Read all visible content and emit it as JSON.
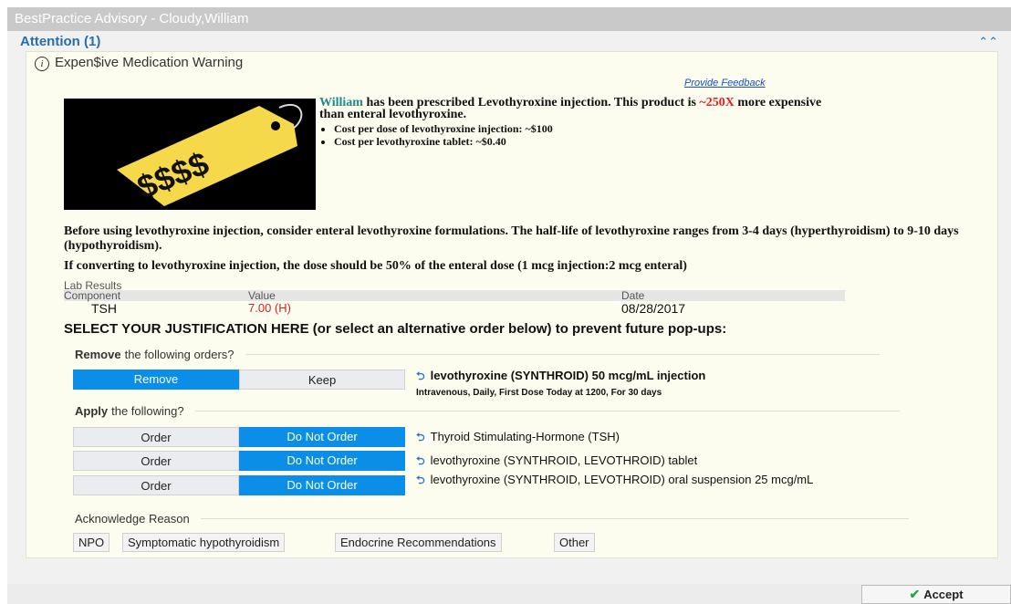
{
  "window": {
    "title": "BestPractice Advisory  - Cloudy,William"
  },
  "header": {
    "attention": "Attention (1)",
    "collapse_icon": "double-chevron-up-icon"
  },
  "warning": {
    "title": "Expen$ive Medication Warning",
    "feedback": "Provide Feedback",
    "tag_text": "$$$$"
  },
  "message": {
    "name": "William",
    "line1": " has been prescribed Levothyroxine injection.  This product is ",
    "multiplier": "~250X",
    "line2": " more expensive than enteral levothyroxine.",
    "bullets": [
      "Cost per dose of levothyroxine injection: ~$100",
      "Cost per levothyroxine tablet: ~$0.40"
    ]
  },
  "guidance": {
    "p1": "Before using levothyroxine injection, consider enteral levothyroxine formulations. The half-life of levothyroxine ranges from 3-4 days (hyperthyroidism) to 9-10 days (hypothyroidism).",
    "p2": "If converting to levothyroxine injection, the dose should be 50% of the enteral dose (1 mcg injection:2 mcg enteral)"
  },
  "lab": {
    "title": "Lab Results",
    "headers": {
      "component": "Component",
      "value": "Value",
      "date": "Date"
    },
    "row": {
      "component": "TSH",
      "value": "7.00 (H)",
      "date": "08/28/2017"
    }
  },
  "justify": "SELECT YOUR JUSTIFICATION HERE (or select an alternative order below) to prevent future pop-ups:",
  "remove_section": {
    "bold": "Remove",
    "rest": "the following orders?",
    "remove_label": "Remove",
    "keep_label": "Keep",
    "order": "levothyroxine (SYNTHROID) 50 mcg/mL injection",
    "order_detail": "Intravenous, Daily, First Dose Today at 1200, For 30 days"
  },
  "apply_section": {
    "bold": "Apply",
    "rest": "the following?",
    "items": [
      {
        "order_label": "Order",
        "not_label": "Do Not Order",
        "text": "Thyroid Stimulating-Hormone (TSH)"
      },
      {
        "order_label": "Order",
        "not_label": "Do Not Order",
        "text": "levothyroxine (SYNTHROID, LEVOTHROID) tablet"
      },
      {
        "order_label": "Order",
        "not_label": "Do Not Order",
        "text": "levothyroxine (SYNTHROID, LEVOTHROID) oral suspension 25 mcg/mL"
      }
    ]
  },
  "acknowledge": {
    "title": "Acknowledge Reason",
    "reasons": [
      "NPO",
      "Symptomatic hypothyroidism",
      "Endocrine Recommendations",
      "Other"
    ]
  },
  "footer": {
    "accept": "Accept"
  },
  "colors": {
    "accent": "#0b8ee8",
    "title_blue": "#2a6ea8",
    "alert_red": "#e02020",
    "tag_yellow": "#f6d94a"
  }
}
